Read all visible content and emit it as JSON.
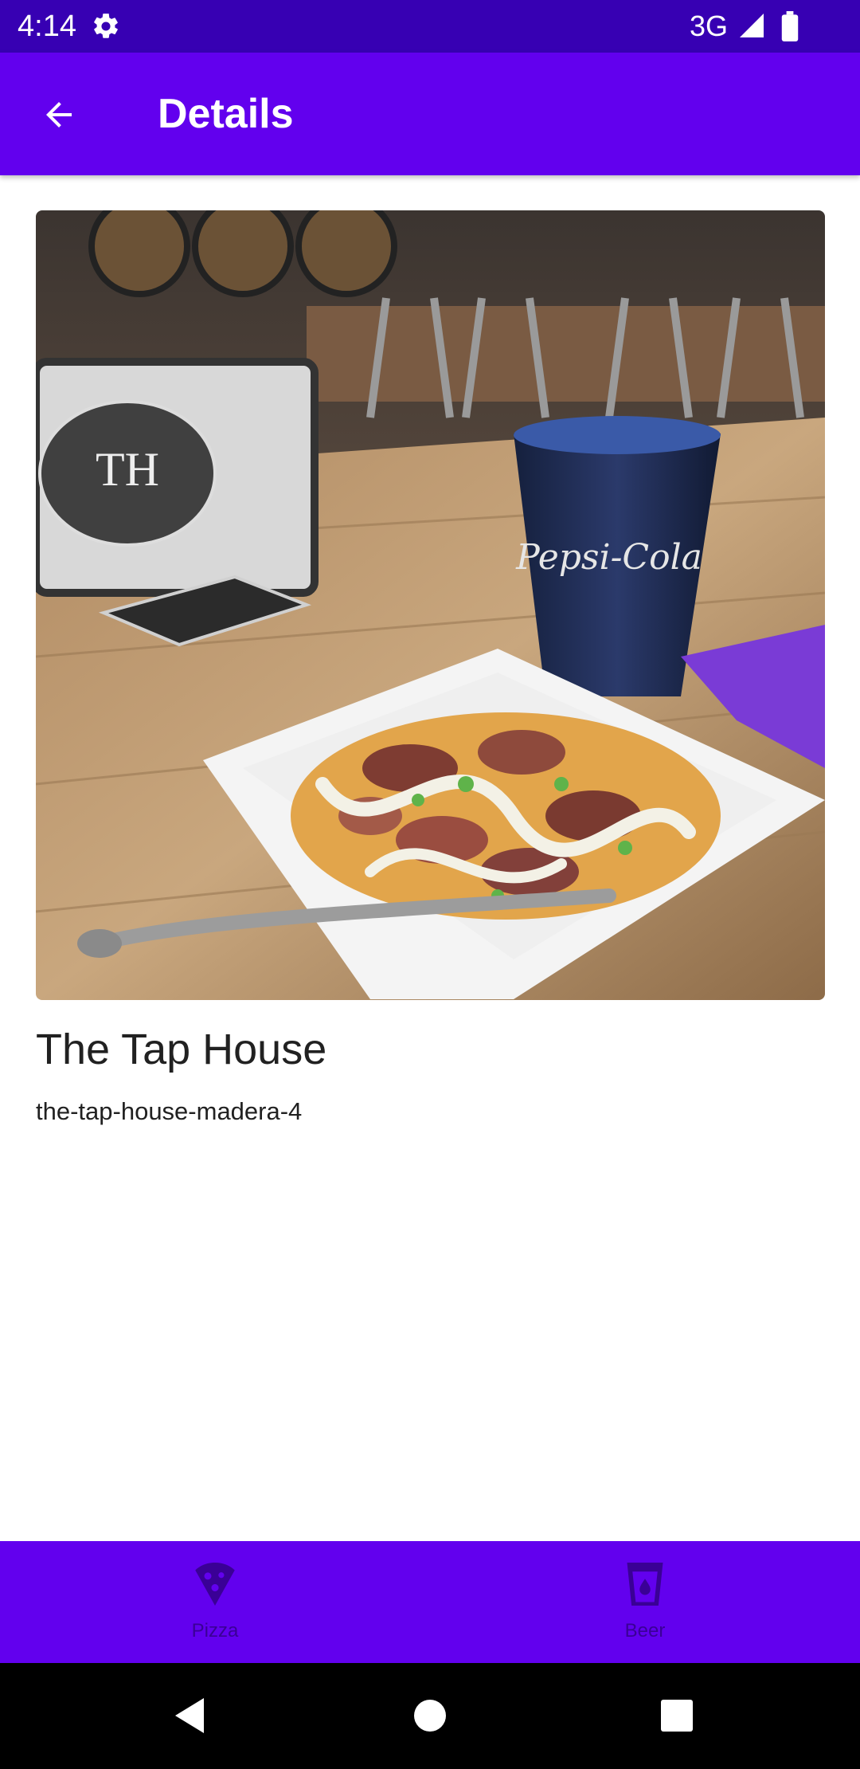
{
  "status_bar": {
    "time": "4:14",
    "network": "3G",
    "icons": [
      "gear-icon",
      "signal-icon",
      "battery-icon"
    ]
  },
  "app_bar": {
    "title": "Details",
    "back_icon": "arrow-back-icon"
  },
  "detail": {
    "image_description_icon": "photo",
    "name": "The Tap House",
    "slug": "the-tap-house-madera-4"
  },
  "bottom_nav": {
    "items": [
      {
        "label": "Pizza",
        "icon": "pizza-icon"
      },
      {
        "label": "Beer",
        "icon": "beer-icon"
      }
    ]
  },
  "system_nav": {
    "buttons": [
      "back-triangle-icon",
      "home-circle-icon",
      "recents-square-icon"
    ]
  },
  "colors": {
    "status_bar": "#3700b3",
    "primary": "#6200ee",
    "nav_label": "#3a0096",
    "text": "#212121"
  }
}
